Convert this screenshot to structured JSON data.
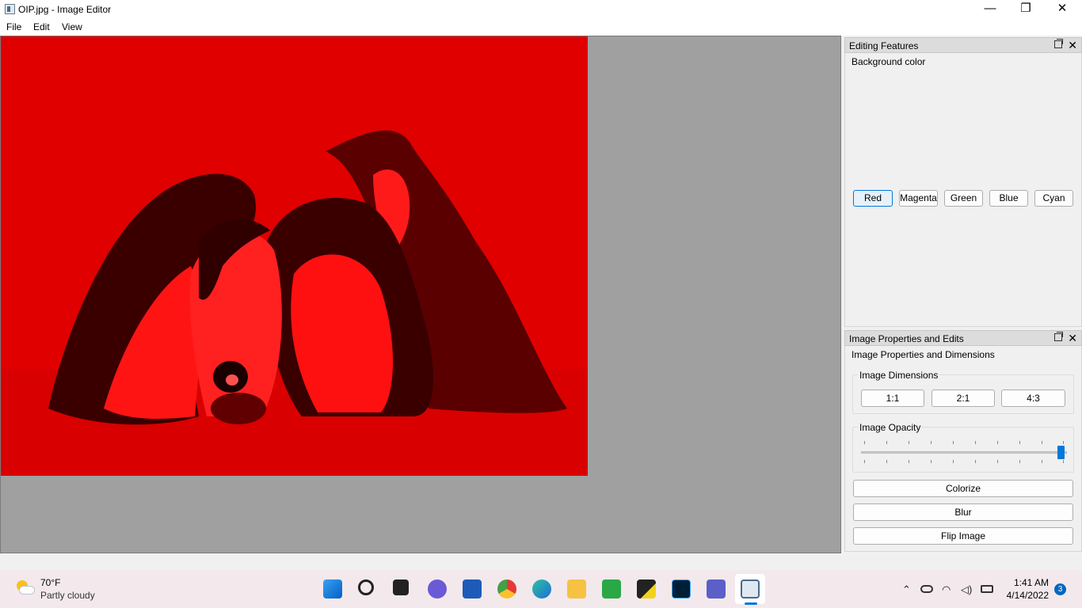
{
  "window": {
    "title": "OIP.jpg - Image Editor"
  },
  "window_controls": {
    "minimize": "—",
    "maximize": "❐",
    "close": "✕"
  },
  "menu": {
    "file": "File",
    "edit": "Edit",
    "view": "View"
  },
  "editing_features": {
    "title": "Editing Features",
    "section": "Background color",
    "colors": [
      "Red",
      "Magenta",
      "Green",
      "Blue",
      "Cyan"
    ],
    "selected": "Red"
  },
  "image_props": {
    "title": "Image Properties and Edits",
    "section": "Image Properties and Dimensions",
    "dimensions_group": "Image Dimensions",
    "ratios": [
      "1:1",
      "2:1",
      "4:3"
    ],
    "opacity_group": "Image Opacity",
    "opacity_level": 1.0,
    "colorize": "Colorize",
    "blur": "Blur",
    "flip": "Flip Image"
  },
  "dock_controls": {
    "float": "float-icon",
    "close": "✕"
  },
  "colors": {
    "accent": "#0078d7",
    "canvas": "#a0a0a0",
    "tint": "#e00000"
  },
  "taskbar": {
    "weather": {
      "temp": "70°F",
      "desc": "Partly cloudy"
    },
    "apps": [
      "start-icon",
      "search-icon",
      "task-view-icon",
      "chat-icon",
      "word-icon",
      "chrome-icon",
      "edge-icon",
      "file-explorer-icon",
      "qc-icon",
      "sticky-notes-icon",
      "photoshop-icon",
      "teams-icon",
      "image-editor-icon"
    ],
    "time": "1:41 AM",
    "date": "4/14/2022",
    "notifications": "3"
  }
}
